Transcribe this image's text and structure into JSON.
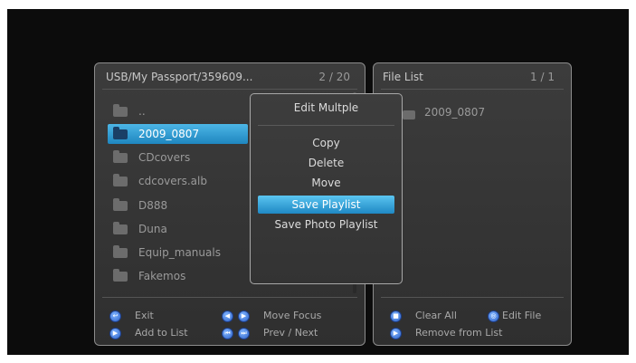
{
  "left_panel": {
    "path": "USB/My Passport/359609...",
    "page": "2 / 20",
    "items": [
      {
        "label": "..",
        "icon": "folder-icon"
      },
      {
        "label": "2009_0807",
        "icon": "folder-icon",
        "selected": true
      },
      {
        "label": "CDcovers",
        "icon": "folder-icon"
      },
      {
        "label": "cdcovers.alb",
        "icon": "album-icon"
      },
      {
        "label": "D888",
        "icon": "folder-icon"
      },
      {
        "label": "Duna",
        "icon": "folder-icon"
      },
      {
        "label": "Equip_manuals",
        "icon": "folder-icon"
      },
      {
        "label": "Fakemos",
        "icon": "folder-icon"
      }
    ],
    "hints": {
      "exit": "Exit",
      "add_to_list": "Add to List",
      "move_focus": "Move Focus",
      "prev_next": "Prev / Next"
    }
  },
  "right_panel": {
    "title": "File List",
    "page": "1 / 1",
    "items": [
      {
        "label": "2009_0807",
        "icon": "folder-icon"
      }
    ],
    "hints": {
      "clear_all": "Clear All",
      "edit_file": "Edit File",
      "remove_from_list": "Remove from List"
    }
  },
  "menu": {
    "title": "Edit Multple",
    "items": [
      {
        "label": "Copy"
      },
      {
        "label": "Delete"
      },
      {
        "label": "Move"
      },
      {
        "label": "Save Playlist",
        "selected": true
      },
      {
        "label": "Save Photo Playlist"
      }
    ]
  },
  "colors": {
    "selection": "#2a9bd6",
    "panel_bg": "#363636",
    "remote_button": "#3f6fd6"
  }
}
